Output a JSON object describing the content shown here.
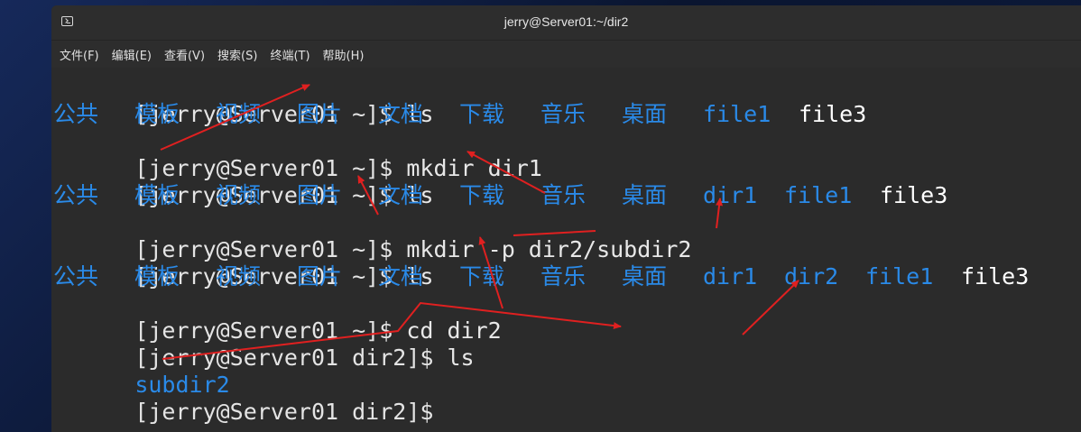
{
  "window": {
    "title": "jerry@Server01:~/dir2",
    "icon": "terminal-icon"
  },
  "menu": [
    "文件(F)",
    "编辑(E)",
    "查看(V)",
    "搜索(S)",
    "终端(T)",
    "帮助(H)"
  ],
  "terminal": {
    "lines": [
      {
        "prompt": "[jerry@Server01 ~]$",
        "command": " ls"
      },
      {
        "listing": [
          "公共",
          "模板",
          "视频",
          "图片",
          "文档",
          "下载",
          "音乐",
          "桌面",
          "file1",
          "file3"
        ]
      },
      {
        "prompt": "[jerry@Server01 ~]$",
        "command": " mkdir dir1"
      },
      {
        "prompt": "[jerry@Server01 ~]$",
        "command": " ls"
      },
      {
        "listing": [
          "公共",
          "模板",
          "视频",
          "图片",
          "文档",
          "下载",
          "音乐",
          "桌面",
          "dir1",
          "file1",
          "file3"
        ]
      },
      {
        "prompt": "[jerry@Server01 ~]$",
        "command": " mkdir -p dir2/subdir2"
      },
      {
        "prompt": "[jerry@Server01 ~]$",
        "command": " ls"
      },
      {
        "listing": [
          "公共",
          "模板",
          "视频",
          "图片",
          "文档",
          "下载",
          "音乐",
          "桌面",
          "dir1",
          "dir2",
          "file1",
          "file3"
        ]
      },
      {
        "prompt": "[jerry@Server01 ~]$",
        "command": " cd dir2"
      },
      {
        "prompt": "[jerry@Server01 dir2]$",
        "command": " ls"
      },
      {
        "listing": [
          "subdir2"
        ]
      },
      {
        "prompt": "[jerry@Server01 dir2]$",
        "command": ""
      }
    ]
  },
  "colors": {
    "terminal_bg": "#2b2b2b",
    "directory": "#2a8ae8",
    "file": "#ffffff",
    "text": "#e4e4e4",
    "annotation_arrow": "#e02020"
  }
}
